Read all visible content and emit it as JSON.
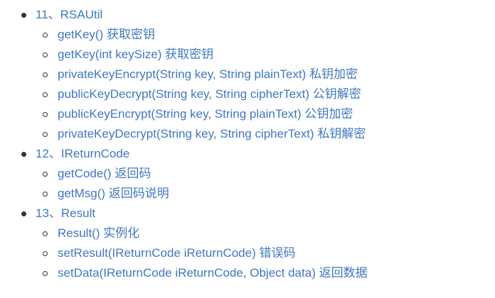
{
  "toc": {
    "sections": [
      {
        "label": "11、RSAUtil",
        "items": [
          "getKey() 获取密钥",
          "getKey(int keySize) 获取密钥",
          "privateKeyEncrypt(String key, String plainText) 私钥加密",
          "publicKeyDecrypt(String key, String cipherText) 公钥解密",
          "publicKeyEncrypt(String key, String plainText) 公钥加密",
          "privateKeyDecrypt(String key, String cipherText) 私钥解密"
        ]
      },
      {
        "label": "12、IReturnCode",
        "items": [
          "getCode() 返回码",
          "getMsg() 返回码说明"
        ]
      },
      {
        "label": "13、Result",
        "items": [
          "Result() 实例化",
          "setResult(IReturnCode iReturnCode) 错误码",
          "setData(IReturnCode iReturnCode, Object data) 返回数据"
        ]
      }
    ]
  }
}
